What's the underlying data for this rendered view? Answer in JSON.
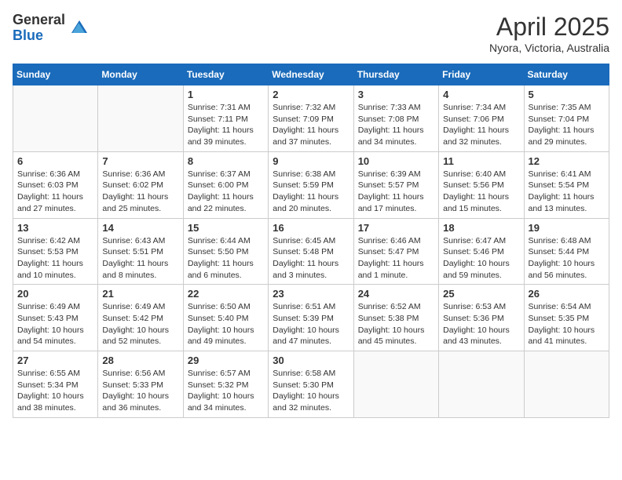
{
  "logo": {
    "general": "General",
    "blue": "Blue"
  },
  "header": {
    "title": "April 2025",
    "location": "Nyora, Victoria, Australia"
  },
  "weekdays": [
    "Sunday",
    "Monday",
    "Tuesday",
    "Wednesday",
    "Thursday",
    "Friday",
    "Saturday"
  ],
  "weeks": [
    [
      {
        "day": "",
        "detail": ""
      },
      {
        "day": "",
        "detail": ""
      },
      {
        "day": "1",
        "detail": "Sunrise: 7:31 AM\nSunset: 7:11 PM\nDaylight: 11 hours and 39 minutes."
      },
      {
        "day": "2",
        "detail": "Sunrise: 7:32 AM\nSunset: 7:09 PM\nDaylight: 11 hours and 37 minutes."
      },
      {
        "day": "3",
        "detail": "Sunrise: 7:33 AM\nSunset: 7:08 PM\nDaylight: 11 hours and 34 minutes."
      },
      {
        "day": "4",
        "detail": "Sunrise: 7:34 AM\nSunset: 7:06 PM\nDaylight: 11 hours and 32 minutes."
      },
      {
        "day": "5",
        "detail": "Sunrise: 7:35 AM\nSunset: 7:04 PM\nDaylight: 11 hours and 29 minutes."
      }
    ],
    [
      {
        "day": "6",
        "detail": "Sunrise: 6:36 AM\nSunset: 6:03 PM\nDaylight: 11 hours and 27 minutes."
      },
      {
        "day": "7",
        "detail": "Sunrise: 6:36 AM\nSunset: 6:02 PM\nDaylight: 11 hours and 25 minutes."
      },
      {
        "day": "8",
        "detail": "Sunrise: 6:37 AM\nSunset: 6:00 PM\nDaylight: 11 hours and 22 minutes."
      },
      {
        "day": "9",
        "detail": "Sunrise: 6:38 AM\nSunset: 5:59 PM\nDaylight: 11 hours and 20 minutes."
      },
      {
        "day": "10",
        "detail": "Sunrise: 6:39 AM\nSunset: 5:57 PM\nDaylight: 11 hours and 17 minutes."
      },
      {
        "day": "11",
        "detail": "Sunrise: 6:40 AM\nSunset: 5:56 PM\nDaylight: 11 hours and 15 minutes."
      },
      {
        "day": "12",
        "detail": "Sunrise: 6:41 AM\nSunset: 5:54 PM\nDaylight: 11 hours and 13 minutes."
      }
    ],
    [
      {
        "day": "13",
        "detail": "Sunrise: 6:42 AM\nSunset: 5:53 PM\nDaylight: 11 hours and 10 minutes."
      },
      {
        "day": "14",
        "detail": "Sunrise: 6:43 AM\nSunset: 5:51 PM\nDaylight: 11 hours and 8 minutes."
      },
      {
        "day": "15",
        "detail": "Sunrise: 6:44 AM\nSunset: 5:50 PM\nDaylight: 11 hours and 6 minutes."
      },
      {
        "day": "16",
        "detail": "Sunrise: 6:45 AM\nSunset: 5:48 PM\nDaylight: 11 hours and 3 minutes."
      },
      {
        "day": "17",
        "detail": "Sunrise: 6:46 AM\nSunset: 5:47 PM\nDaylight: 11 hours and 1 minute."
      },
      {
        "day": "18",
        "detail": "Sunrise: 6:47 AM\nSunset: 5:46 PM\nDaylight: 10 hours and 59 minutes."
      },
      {
        "day": "19",
        "detail": "Sunrise: 6:48 AM\nSunset: 5:44 PM\nDaylight: 10 hours and 56 minutes."
      }
    ],
    [
      {
        "day": "20",
        "detail": "Sunrise: 6:49 AM\nSunset: 5:43 PM\nDaylight: 10 hours and 54 minutes."
      },
      {
        "day": "21",
        "detail": "Sunrise: 6:49 AM\nSunset: 5:42 PM\nDaylight: 10 hours and 52 minutes."
      },
      {
        "day": "22",
        "detail": "Sunrise: 6:50 AM\nSunset: 5:40 PM\nDaylight: 10 hours and 49 minutes."
      },
      {
        "day": "23",
        "detail": "Sunrise: 6:51 AM\nSunset: 5:39 PM\nDaylight: 10 hours and 47 minutes."
      },
      {
        "day": "24",
        "detail": "Sunrise: 6:52 AM\nSunset: 5:38 PM\nDaylight: 10 hours and 45 minutes."
      },
      {
        "day": "25",
        "detail": "Sunrise: 6:53 AM\nSunset: 5:36 PM\nDaylight: 10 hours and 43 minutes."
      },
      {
        "day": "26",
        "detail": "Sunrise: 6:54 AM\nSunset: 5:35 PM\nDaylight: 10 hours and 41 minutes."
      }
    ],
    [
      {
        "day": "27",
        "detail": "Sunrise: 6:55 AM\nSunset: 5:34 PM\nDaylight: 10 hours and 38 minutes."
      },
      {
        "day": "28",
        "detail": "Sunrise: 6:56 AM\nSunset: 5:33 PM\nDaylight: 10 hours and 36 minutes."
      },
      {
        "day": "29",
        "detail": "Sunrise: 6:57 AM\nSunset: 5:32 PM\nDaylight: 10 hours and 34 minutes."
      },
      {
        "day": "30",
        "detail": "Sunrise: 6:58 AM\nSunset: 5:30 PM\nDaylight: 10 hours and 32 minutes."
      },
      {
        "day": "",
        "detail": ""
      },
      {
        "day": "",
        "detail": ""
      },
      {
        "day": "",
        "detail": ""
      }
    ]
  ]
}
